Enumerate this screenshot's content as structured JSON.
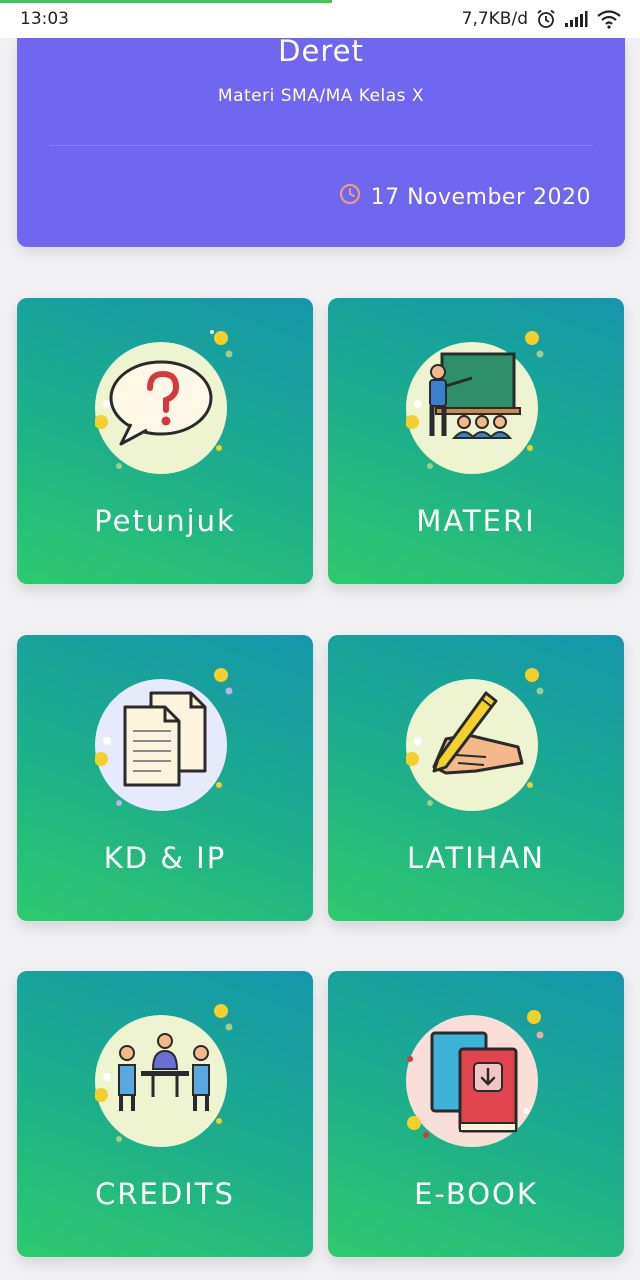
{
  "status_bar": {
    "time": "13:03",
    "network_speed": "7,7KB/d",
    "icons": [
      "alarm-icon",
      "signal-icon",
      "wifi-icon"
    ]
  },
  "header": {
    "title": "Deret",
    "subtitle": "Materi SMA/MA Kelas X",
    "date": "17 November 2020",
    "date_icon": "clock-icon",
    "colors": {
      "background": "#7066f0",
      "clock": "#f0a07a"
    }
  },
  "menu": {
    "items": [
      {
        "label": "Petunjuk",
        "icon": "question-bubble-icon"
      },
      {
        "label": "MATERI",
        "icon": "teacher-board-icon"
      },
      {
        "label": "KD & IP",
        "icon": "documents-icon"
      },
      {
        "label": "LATIHAN",
        "icon": "writing-hand-icon"
      },
      {
        "label": "CREDITS",
        "icon": "team-meeting-icon"
      },
      {
        "label": "E-BOOK",
        "icon": "ebook-download-icon"
      }
    ],
    "colors": {
      "gradient_start": "#2fca6e",
      "gradient_end": "#1496ac"
    }
  }
}
